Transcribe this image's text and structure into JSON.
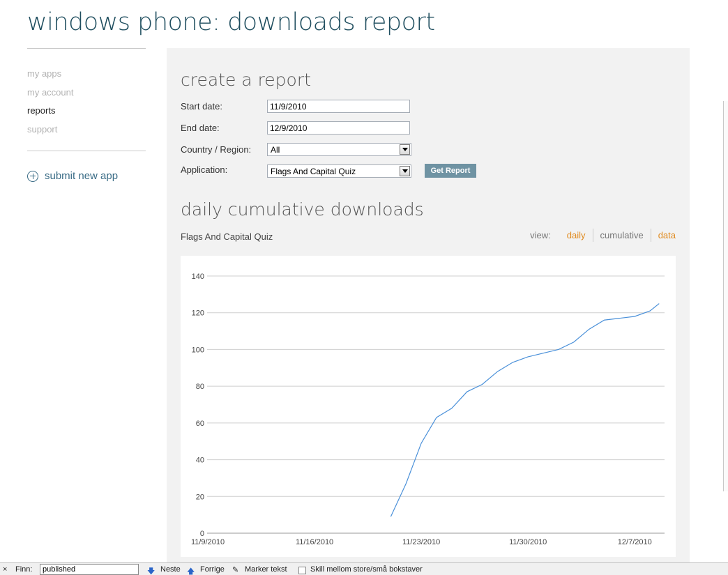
{
  "page": {
    "title": "windows phone: downloads report"
  },
  "nav": {
    "items": [
      "my apps",
      "my account",
      "reports",
      "support"
    ],
    "submit_label": "submit new app"
  },
  "report_form": {
    "heading": "create a report",
    "start_label": "Start date:",
    "start_value": "11/9/2010",
    "end_label": "End date:",
    "end_value": "12/9/2010",
    "country_label": "Country / Region:",
    "country_value": "All",
    "application_label": "Application:",
    "application_value": "Flags And Capital Quiz",
    "button_label": "Get Report"
  },
  "downloads": {
    "heading": "daily cumulative downloads",
    "app_name": "Flags And Capital Quiz",
    "view_label": "view:",
    "view_options": [
      "daily",
      "cumulative",
      "data"
    ]
  },
  "colors": {
    "accent_orange": "#e08a1e",
    "line_blue": "#4a90d9",
    "button": "#6f93a3"
  },
  "chart_data": {
    "type": "line",
    "xlabel": "",
    "ylabel": "",
    "ylim": [
      0,
      140
    ],
    "yticks": [
      0,
      20,
      40,
      60,
      80,
      100,
      120,
      140
    ],
    "xlim": [
      "11/9/2010",
      "12/9/2010"
    ],
    "xticks": [
      "11/9/2010",
      "11/16/2010",
      "11/23/2010",
      "11/30/2010",
      "12/7/2010"
    ],
    "grid": true,
    "series": [
      {
        "x": [
          "11/21/2010",
          "11/22/2010",
          "11/23/2010",
          "11/24/2010",
          "11/25/2010",
          "11/26/2010",
          "11/27/2010",
          "11/28/2010",
          "11/29/2010",
          "11/30/2010",
          "12/1/2010",
          "12/2/2010",
          "12/3/2010",
          "12/4/2010",
          "12/5/2010",
          "12/6/2010",
          "12/7/2010",
          "12/8/2010"
        ],
        "y": [
          9,
          27,
          49,
          63,
          68,
          77,
          81,
          88,
          93,
          96,
          98,
          100,
          104,
          111,
          116,
          117,
          118,
          121
        ],
        "x_extra": "12/8/2010",
        "y_extra": 125
      }
    ]
  },
  "find_bar": {
    "label": "Finn:",
    "query": "published",
    "next": "Neste",
    "prev": "Forrige",
    "highlight": "Marker tekst",
    "case": "Skill mellom store/små bokstaver"
  }
}
